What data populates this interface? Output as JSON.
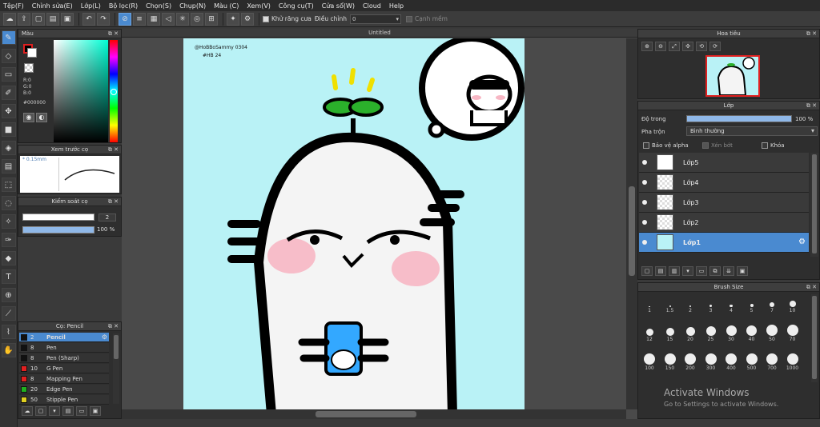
{
  "menu": [
    "Tệp(F)",
    "Chỉnh sửa(E)",
    "Lớp(L)",
    "Bộ lọc(R)",
    "Chọn(S)",
    "Chụp(N)",
    "Màu (C)",
    "Xem(V)",
    "Công cụ(T)",
    "Cửa sổ(W)",
    "Cloud",
    "Help"
  ],
  "toolbar": {
    "antialias_label": "Khử răng cưa",
    "adjust_label": "Điều chỉnh",
    "adjust_value": "0",
    "snap_label": "Cạnh mềm"
  },
  "color_panel": {
    "title": "Màu",
    "r": "R:0",
    "g": "G:0",
    "b": "B:0",
    "hex": "#000000",
    "fg_color": "#000000",
    "bg_color": "#ffffff"
  },
  "preview_panel": {
    "title": "Xem trước cọ",
    "size_text": "* 0.15mm"
  },
  "brush_control": {
    "title": "Kiểm soát cọ",
    "size_value": "2",
    "opacity_value": "100",
    "opacity_unit": "%"
  },
  "pen_panel": {
    "title": "Cọ: Pencil",
    "pens": [
      {
        "size": "2",
        "name": "Pencil",
        "color": "#111111"
      },
      {
        "size": "8",
        "name": "Pen",
        "color": "#111111"
      },
      {
        "size": "8",
        "name": "Pen (Sharp)",
        "color": "#111111"
      },
      {
        "size": "10",
        "name": "G Pen",
        "color": "#e02020"
      },
      {
        "size": "8",
        "name": "Mapping Pen",
        "color": "#e02020"
      },
      {
        "size": "20",
        "name": "Edge Pen",
        "color": "#20b020"
      },
      {
        "size": "50",
        "name": "Stipple Pen",
        "color": "#e0d020"
      }
    ]
  },
  "canvas": {
    "title": "Untitled",
    "signature_line1": "@HoBBoSammy 0304",
    "signature_line2": "#HB 24"
  },
  "navigator": {
    "title": "Hoa tiêu"
  },
  "layers_panel": {
    "title": "Lớp",
    "opacity_label": "Độ trong",
    "opacity_value": "100",
    "opacity_unit": "%",
    "blend_label": "Pha trộn",
    "blend_value": "Bình thường",
    "protect_alpha": "Bảo vệ alpha",
    "clipping": "Xén bớt",
    "lock": "Khóa",
    "layers": [
      "Lớp5",
      "Lớp4",
      "Lớp3",
      "Lớp2",
      "Lớp1"
    ]
  },
  "brush_size": {
    "title": "Brush Size",
    "sizes": [
      "1",
      "1.5",
      "2",
      "3",
      "4",
      "5",
      "7",
      "10",
      "12",
      "15",
      "20",
      "25",
      "30",
      "40",
      "50",
      "70",
      "100",
      "150",
      "200",
      "300",
      "400",
      "500",
      "700",
      "1000"
    ]
  },
  "activation": {
    "line1": "Activate Windows",
    "line2": "Go to Settings to activate Windows."
  },
  "colors": {
    "accent": "#4a8ad0",
    "canvas_bg": "#b9f2f6"
  }
}
